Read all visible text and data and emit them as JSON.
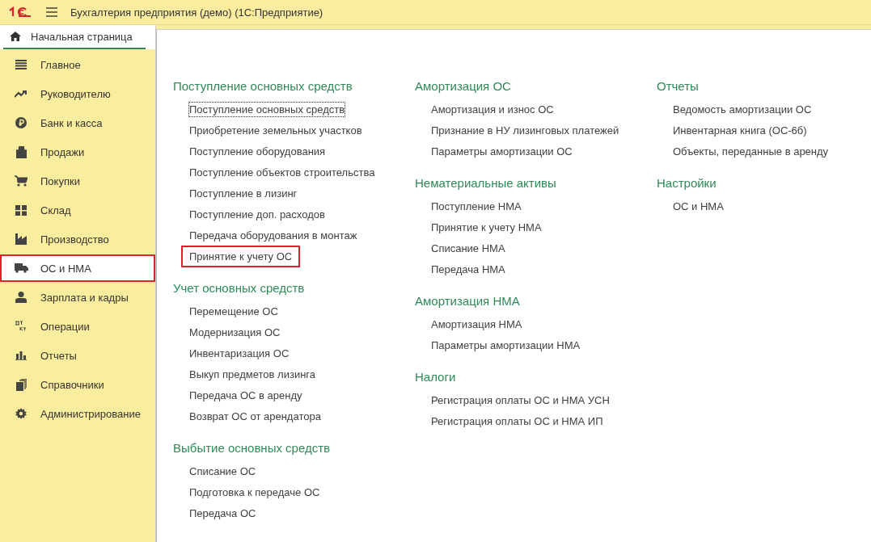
{
  "window": {
    "title": "Бухгалтерия предприятия (демо)  (1С:Предприятие)"
  },
  "home_tab": {
    "label": "Начальная страница",
    "selected": true
  },
  "sidebar": {
    "items": [
      {
        "label": "Главное",
        "selected": false,
        "highlighted": false
      },
      {
        "label": "Руководителю",
        "selected": false,
        "highlighted": false
      },
      {
        "label": "Банк и касса",
        "selected": false,
        "highlighted": false
      },
      {
        "label": "Продажи",
        "selected": false,
        "highlighted": false
      },
      {
        "label": "Покупки",
        "selected": false,
        "highlighted": false
      },
      {
        "label": "Склад",
        "selected": false,
        "highlighted": false
      },
      {
        "label": "Производство",
        "selected": false,
        "highlighted": false
      },
      {
        "label": "ОС и НМА",
        "selected": true,
        "highlighted": true
      },
      {
        "label": "Зарплата и кадры",
        "selected": false,
        "highlighted": false
      },
      {
        "label": "Операции",
        "selected": false,
        "highlighted": false
      },
      {
        "label": "Отчеты",
        "selected": false,
        "highlighted": false
      },
      {
        "label": "Справочники",
        "selected": false,
        "highlighted": false
      },
      {
        "label": "Администрирование",
        "selected": false,
        "highlighted": false
      }
    ]
  },
  "columns": [
    [
      {
        "title": "Поступление основных средств",
        "links": [
          {
            "label": "Поступление основных средств",
            "focused": true,
            "highlighted": false
          },
          {
            "label": "Приобретение земельных участков",
            "focused": false,
            "highlighted": false
          },
          {
            "label": "Поступление оборудования",
            "focused": false,
            "highlighted": false
          },
          {
            "label": "Поступление объектов строительства",
            "focused": false,
            "highlighted": false
          },
          {
            "label": "Поступление в лизинг",
            "focused": false,
            "highlighted": false
          },
          {
            "label": "Поступление доп. расходов",
            "focused": false,
            "highlighted": false
          },
          {
            "label": "Передача оборудования в монтаж",
            "focused": false,
            "highlighted": false
          },
          {
            "label": "Принятие к учету ОС",
            "focused": false,
            "highlighted": true
          }
        ]
      },
      {
        "title": "Учет основных средств",
        "links": [
          {
            "label": "Перемещение ОС",
            "focused": false,
            "highlighted": false
          },
          {
            "label": "Модернизация ОС",
            "focused": false,
            "highlighted": false
          },
          {
            "label": "Инвентаризация ОС",
            "focused": false,
            "highlighted": false
          },
          {
            "label": "Выкуп предметов лизинга",
            "focused": false,
            "highlighted": false
          },
          {
            "label": "Передача ОС в аренду",
            "focused": false,
            "highlighted": false
          },
          {
            "label": "Возврат ОС от арендатора",
            "focused": false,
            "highlighted": false
          }
        ]
      },
      {
        "title": "Выбытие основных средств",
        "links": [
          {
            "label": "Списание ОС",
            "focused": false,
            "highlighted": false
          },
          {
            "label": "Подготовка к передаче ОС",
            "focused": false,
            "highlighted": false
          },
          {
            "label": "Передача ОС",
            "focused": false,
            "highlighted": false
          }
        ]
      }
    ],
    [
      {
        "title": "Амортизация ОС",
        "links": [
          {
            "label": "Амортизация и износ ОС",
            "focused": false,
            "highlighted": false
          },
          {
            "label": "Признание в НУ лизинговых платежей",
            "focused": false,
            "highlighted": false
          },
          {
            "label": "Параметры амортизации ОС",
            "focused": false,
            "highlighted": false
          }
        ]
      },
      {
        "title": "Нематериальные активы",
        "links": [
          {
            "label": "Поступление НМА",
            "focused": false,
            "highlighted": false
          },
          {
            "label": "Принятие к учету НМА",
            "focused": false,
            "highlighted": false
          },
          {
            "label": "Списание НМА",
            "focused": false,
            "highlighted": false
          },
          {
            "label": "Передача НМА",
            "focused": false,
            "highlighted": false
          }
        ]
      },
      {
        "title": "Амортизация НМА",
        "links": [
          {
            "label": "Амортизация НМА",
            "focused": false,
            "highlighted": false
          },
          {
            "label": "Параметры амортизации НМА",
            "focused": false,
            "highlighted": false
          }
        ]
      },
      {
        "title": "Налоги",
        "links": [
          {
            "label": "Регистрация оплаты ОС и НМА УСН",
            "focused": false,
            "highlighted": false
          },
          {
            "label": "Регистрация оплаты ОС и НМА ИП",
            "focused": false,
            "highlighted": false
          }
        ]
      }
    ],
    [
      {
        "title": "Отчеты",
        "links": [
          {
            "label": "Ведомость амортизации ОС",
            "focused": false,
            "highlighted": false
          },
          {
            "label": "Инвентарная книга (ОС-6б)",
            "focused": false,
            "highlighted": false
          },
          {
            "label": "Объекты, переданные в аренду",
            "focused": false,
            "highlighted": false
          }
        ]
      },
      {
        "title": "Настройки",
        "links": [
          {
            "label": "ОС и НМА",
            "focused": false,
            "highlighted": false
          }
        ]
      }
    ]
  ]
}
